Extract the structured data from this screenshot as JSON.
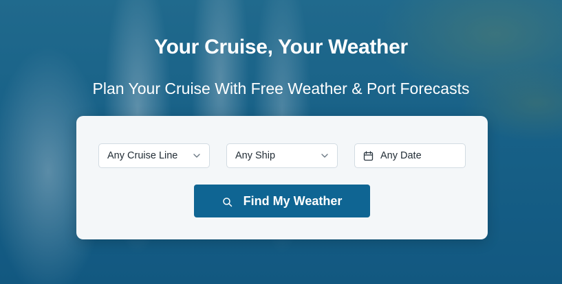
{
  "hero": {
    "title": "Your Cruise, Your Weather",
    "subtitle": "Plan Your Cruise With Free Weather & Port Forecasts"
  },
  "search": {
    "cruise_line": {
      "value": "Any Cruise Line",
      "icon": "chevron-down-icon"
    },
    "ship": {
      "value": "Any Ship",
      "icon": "chevron-down-icon"
    },
    "date": {
      "value": "Any Date",
      "icon": "calendar-icon"
    },
    "submit": {
      "label": "Find My Weather",
      "icon": "search-icon"
    }
  },
  "colors": {
    "button": "#0f6593",
    "panel": "#f4f7f9",
    "text": "#1f2a33"
  }
}
